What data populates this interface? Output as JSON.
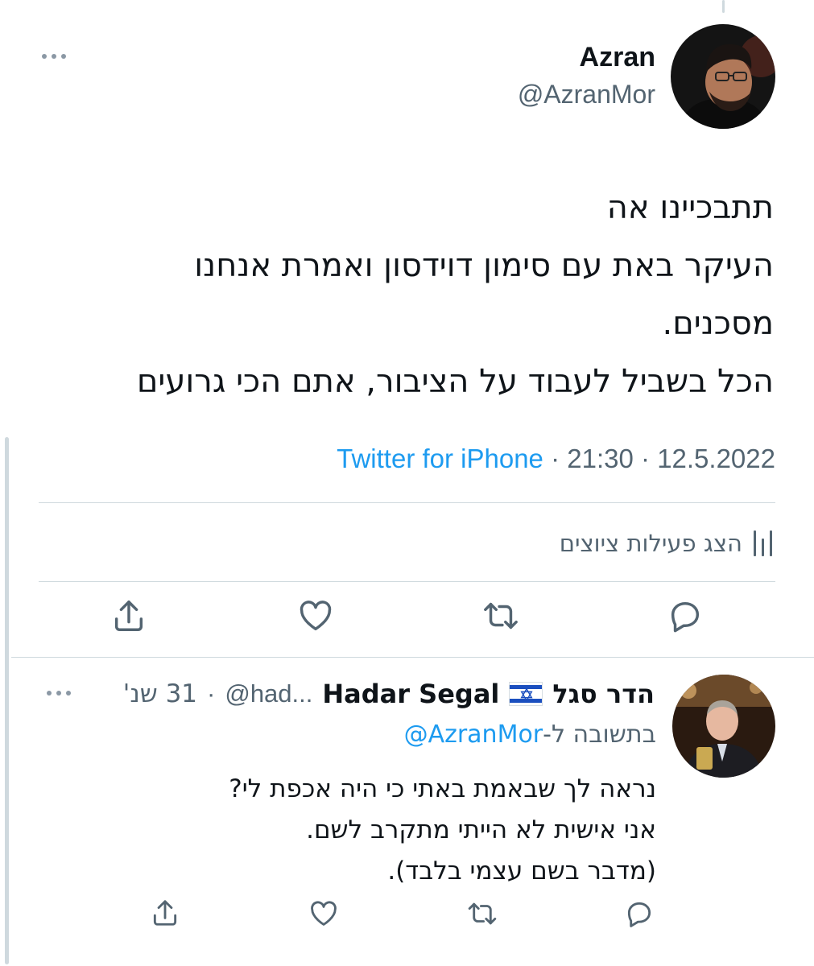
{
  "main_tweet": {
    "author_name": "Azran",
    "author_handle": "@AzranMor",
    "text_lines": [
      "תתבכיינו אה",
      "העיקר באת עם סימון דוידסון ואמרת אנחנו",
      "מסכנים.",
      "הכל בשביל לעבוד על הציבור, אתם הכי גרועים"
    ],
    "source": "Twitter for iPhone",
    "time": "21:30",
    "date": "12.5.2022",
    "separator": "·",
    "analytics_label": "הצג פעילות ציוצים"
  },
  "reply_tweet": {
    "author_name": "הדר סגל",
    "author_name_latin": "Hadar Segal",
    "author_handle": "@had...",
    "age": "31 שנ'",
    "separator": "·",
    "reply_prefix": "בתשובה ל-",
    "reply_mention": "@AzranMor",
    "text_lines": [
      "נראה לך שבאמת באתי כי היה אכפת לי?",
      "אני אישית לא הייתי מתקרב לשם.",
      "(מדבר בשם עצמי בלבד)."
    ]
  },
  "icons": [
    "more-icon",
    "analytics-bars-icon",
    "reply-icon",
    "retweet-icon",
    "like-icon",
    "share-icon",
    "israel-flag-icon"
  ],
  "colors": {
    "link": "#1d9bf0",
    "secondary_text": "#536471",
    "divider": "#cfd9de",
    "text": "#0f1419"
  }
}
